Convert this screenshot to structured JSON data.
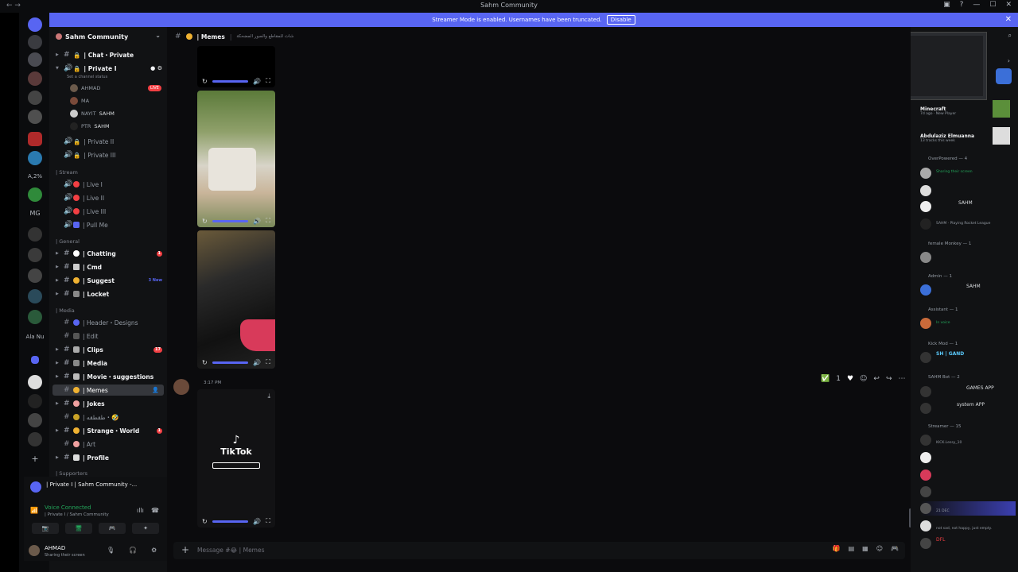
{
  "window": {
    "title": "Sahm Community"
  },
  "banner": {
    "text": "Streamer Mode is enabled. Usernames have been truncated.",
    "button": "Disable"
  },
  "server": {
    "name": "Sahm Community"
  },
  "channels": {
    "private": [
      {
        "label": "| Chat・Private",
        "type": "text"
      },
      {
        "label": "| Private I",
        "type": "voice",
        "status": "Set a channel status"
      },
      {
        "label": "| Private II",
        "type": "voice"
      },
      {
        "label": "| Private III",
        "type": "voice"
      }
    ],
    "voice_users": [
      {
        "name": "AHMAD",
        "badge": "LIVE"
      },
      {
        "name": "MA"
      },
      {
        "name": "NAYIT",
        "tag": "SAHM"
      },
      {
        "name": "PTR",
        "tag": "SAHM"
      }
    ],
    "cat_stream": "| Stream",
    "stream": [
      {
        "label": "| Live I"
      },
      {
        "label": "| Live II"
      },
      {
        "label": "| Live III"
      },
      {
        "label": "| Pull Me"
      }
    ],
    "cat_general": "| General",
    "general": [
      {
        "label": "| Chatting",
        "badge": "1"
      },
      {
        "label": "| Cmd"
      },
      {
        "label": "| Suggest",
        "new": "3 New"
      },
      {
        "label": "| Locket"
      }
    ],
    "cat_media": "| Media",
    "media": [
      {
        "label": "| Header・Designs"
      },
      {
        "label": "| Edit"
      },
      {
        "label": "| Clips",
        "badge": "17"
      },
      {
        "label": "| Media"
      },
      {
        "label": "| Movie・suggestions"
      },
      {
        "label": "| Memes",
        "active": true
      },
      {
        "label": "| Jokes"
      },
      {
        "label": "| طقطقه・🤣"
      },
      {
        "label": "| Strange・World",
        "badge": "1"
      },
      {
        "label": "| Art"
      },
      {
        "label": "| Profile"
      }
    ],
    "cat_supporters": "| Supporters"
  },
  "voice_panel": {
    "channel_line": "| Private I | Sahm Community -...",
    "connected": "Voice Connected",
    "connected_sub": "| Private I / Sahm Community"
  },
  "user": {
    "name": "AHMAD",
    "status": "Sharing their screen"
  },
  "main": {
    "channel": "| Memes",
    "topic": "شات للمقاطع والصور المضحكة",
    "meta": "3:17 PM",
    "tiktok_label": "TikTok",
    "composer_placeholder": "Message #😂 | Memes",
    "reaction_count": "1"
  },
  "members": {
    "activities": [
      {
        "title": "Minecraft",
        "sub": "7d ago · New Player"
      },
      {
        "title": "Abdulaziz Elmuanna",
        "sub": "13 tracks this week"
      }
    ],
    "groups": [
      {
        "label": "OverPowered — 4",
        "rows": [
          "Sharing their screen",
          "",
          "SAHM",
          "SAHM · Playing Rocket League"
        ]
      },
      {
        "label": "female Monkey — 1",
        "rows": [
          ""
        ]
      },
      {
        "label": "Admin — 1",
        "rows": [
          "SAHM"
        ]
      },
      {
        "label": "Assistant — 1",
        "rows": [
          "In voice"
        ]
      },
      {
        "label": "Kick Mod — 1",
        "rows": [
          "SH | GAND"
        ]
      },
      {
        "label": "SAHM Bot — 2",
        "rows": [
          "GAMES APP",
          "system APP"
        ]
      },
      {
        "label": "Streamer — 15",
        "rows": [
          "KICK.Lessy_10",
          "",
          "",
          "",
          "21 DEC",
          "not sad, not happy, just empty.",
          "DFL"
        ]
      }
    ]
  },
  "colors": {
    "accent": "#5865f2",
    "danger": "#f23f43",
    "online": "#23a55a"
  }
}
